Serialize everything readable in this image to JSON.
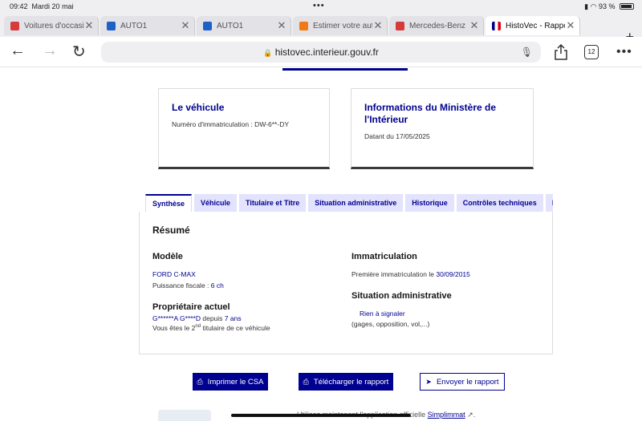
{
  "status": {
    "time": "09:42",
    "date": "Mardi 20 mai",
    "dots": "•••",
    "battery": "93 %"
  },
  "tabs": [
    {
      "label": "Voitures d'occasion",
      "favicon": "shield-logo",
      "color": "#d63b3b"
    },
    {
      "label": "AUTO1",
      "favicon": "auto1-logo",
      "color": "#1e60c8"
    },
    {
      "label": "AUTO1",
      "favicon": "auto1-logo",
      "color": "#1e60c8"
    },
    {
      "label": "Estimer votre auto",
      "favicon": "orange-square",
      "color": "#f07a16"
    },
    {
      "label": "Mercedes-Benz",
      "favicon": "shield-logo",
      "color": "#d63b3b"
    },
    {
      "label": "HistoVec - Rapport",
      "favicon": "french-flag",
      "color": "#000091"
    }
  ],
  "url": {
    "text": "histovec.interieur.gouv.fr",
    "tab_count": "12"
  },
  "cards": {
    "vehicle": {
      "title": "Le véhicule",
      "text": "Numéro d'immatriculation : DW-6**-DY"
    },
    "ministry": {
      "title": "Informations du Ministère de l'Intérieur",
      "text": "Datant du 17/05/2025"
    }
  },
  "report_tabs": [
    "Synthèse",
    "Véhicule",
    "Titulaire et Titre",
    "Situation administrative",
    "Historique",
    "Contrôles techniques",
    "Kilométrage"
  ],
  "summary": {
    "heading": "Résumé",
    "model_heading": "Modèle",
    "model": "FORD C-MAX",
    "power_label": "Puissance fiscale : ",
    "power_value": "6 ch",
    "owner_heading": "Propriétaire actuel",
    "owner_name": "G******A G****D",
    "owner_since": " depuis ",
    "owner_years": "7 ans",
    "owner_rank_pre": "Vous êtes le 2",
    "owner_rank_sup": "nd",
    "owner_rank_post": " titulaire de ce véhicule",
    "registration_heading": "Immatriculation",
    "first_reg_label": "Première immatriculation le ",
    "first_reg_date": "30/09/2015",
    "admin_heading": "Situation administrative",
    "admin_value": "Rien à signaler",
    "admin_detail": "(gages, opposition, vol,...)"
  },
  "buttons": {
    "print": "Imprimer le CSA",
    "download": "Télécharger le rapport",
    "send": "Envoyer le rapport"
  },
  "promo": {
    "text": "Utilisez maintenant l'application officielle ",
    "link": "Simplimmat"
  },
  "colors": {
    "accent": "#000091",
    "tab_bg": "#e3e3fd"
  }
}
